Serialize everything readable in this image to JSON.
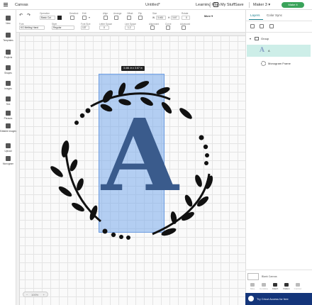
{
  "topbar": {
    "title": "Canvas",
    "doc_title": "Untitled*",
    "learning": "Learning Plan",
    "mystuff": "My Stuff",
    "save": "Save",
    "machine": "Maker 3",
    "make": "Make It"
  },
  "toolbar": {
    "operation_label": "Operation",
    "operation_value": "Basic Cut",
    "deselect_label": "Deselect",
    "edit_label": "Edit",
    "offset_label": "Offset",
    "align_label": "Align",
    "arrange_label": "Arrange",
    "flip_label": "Flip",
    "size_label": "Size",
    "w_label": "W",
    "w_value": "3.461",
    "h_label": "H",
    "h_value": "3.67",
    "rotate_label": "Rotate",
    "rotate_value": "0",
    "more_label": "More",
    "font_label": "Font",
    "font_value": "KG Melting Hand",
    "style_label": "Style",
    "style_value": "Regular",
    "fontsize_label": "Font Size",
    "fontsize_value": "137",
    "letterspace_label": "Letter Space",
    "letterspace_value": "0",
    "linespace_label": "Line Space",
    "linespace_value": "1.2",
    "alignment_label": "Alignment",
    "curve_label": "Curve",
    "advanced_label": "Advanced"
  },
  "leftbar": {
    "items": [
      "New",
      "Templates",
      "Projects",
      "Shapes",
      "Images",
      "Text",
      "Phrases",
      "Editable Images",
      "Upload",
      "Monogram"
    ]
  },
  "canvas": {
    "size_tip": "3.461 in x 3.67 in",
    "letter": "A",
    "zoom": "100%",
    "zoom_minus": "−",
    "zoom_plus": "+",
    "accent": "#3a5b8c"
  },
  "layers": {
    "tab_layers": "Layers",
    "tab_colorsync": "Color Sync",
    "group_label": "Group",
    "layer_a_label": "A",
    "layer_mono_label": "Monogram Frame",
    "blank_canvas": "Blank Canvas",
    "bottom_tools": [
      "Slice",
      "Combine",
      "Attach",
      "Flatten",
      "Contour"
    ],
    "access_text": "Try Cricut Access for free"
  }
}
